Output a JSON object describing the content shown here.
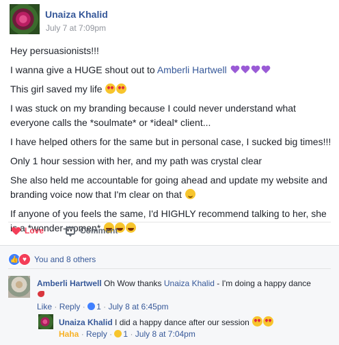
{
  "post": {
    "author": "Unaiza Khalid",
    "timestamp": "July 7 at 7:09pm",
    "lines": {
      "l1": "Hey persuasionists!!!",
      "l2_prefix": "I wanna give a HUGE shout out to",
      "l2_tag": "Amberli Hartwell",
      "l3": "This girl saved my life",
      "l4": "I was stuck on my branding because I could never understand what everyone calls the *soulmate* or *ideal* client...",
      "l5": "I have helped others for the same but in personal case, I sucked big times!!!",
      "l6": "Only 1 hour session with her, and my path was crystal clear",
      "l7": "She also held me accountable for going ahead and update my website and branding voice now that I'm clear on that",
      "l8": "If anyone of you feels the same, I'd HIGHLY recommend talking to her, she is a *wonder-women*"
    }
  },
  "actions": {
    "love_label": "Love",
    "comment_label": "Comment"
  },
  "reactions": {
    "summary": "You and 8 others"
  },
  "comments": [
    {
      "author": "Amberli Hartwell",
      "text_prefix": "Oh Wow thanks",
      "tag": "Unaiza Khalid",
      "text_suffix": "- I'm doing a happy dance",
      "meta": {
        "like": "Like",
        "sep1": "·",
        "reply": "Reply",
        "sep2": "·",
        "count": "1",
        "sep3": "·",
        "time": "July 8 at 6:45pm"
      }
    },
    {
      "author": "Unaiza Khalid",
      "text": "I did a happy dance after our session",
      "meta": {
        "reaction": "Haha",
        "sep1": "·",
        "reply": "Reply",
        "sep2": "·",
        "count": "1",
        "sep3": "·",
        "time": "July 8 at 7:04pm"
      }
    }
  ],
  "icons": {
    "love": "heart-icon",
    "comment": "comment-icon",
    "like_reaction": "like-icon",
    "love_reaction": "love-reaction-icon",
    "emoji_heart_eyes": "heart-eyes-emoji-icon",
    "emoji_purple_heart": "purple-heart-icon",
    "emoji_wink": "wink-emoji-icon",
    "emoji_laugh": "laughing-emoji-icon",
    "emoji_dancer": "dancer-emoji-icon"
  },
  "colors": {
    "link": "#365899",
    "love": "#f33e58",
    "haha": "#f7b125",
    "meta": "#90949c"
  }
}
